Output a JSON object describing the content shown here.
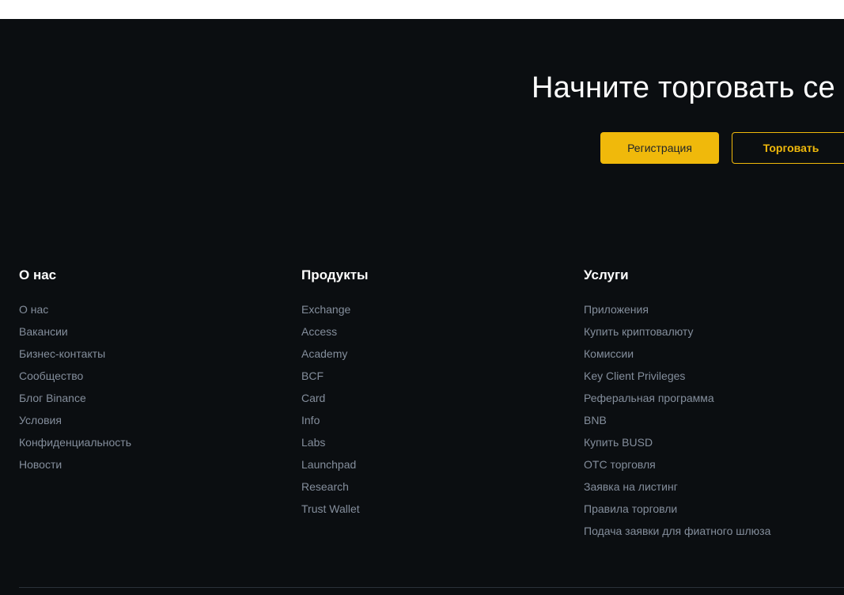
{
  "cta": {
    "title": "Начните торговать се",
    "register_label": "Регистрация",
    "trade_label": "Торговать"
  },
  "colors": {
    "background": "#0b0e11",
    "accent": "#f0b90b",
    "link": "#848e9c",
    "heading": "#ffffff"
  },
  "columns": [
    {
      "heading": "О нас",
      "links": [
        "О нас",
        "Вакансии",
        "Бизнес-контакты",
        "Сообщество",
        "Блог Binance",
        "Условия",
        "Конфиденциальность",
        "Новости"
      ]
    },
    {
      "heading": "Продукты",
      "links": [
        "Exchange",
        "Access",
        "Academy",
        "BCF",
        "Card",
        "Info",
        "Labs",
        "Launchpad",
        "Research",
        "Trust Wallet"
      ]
    },
    {
      "heading": "Услуги",
      "links": [
        "Приложения",
        "Купить криптовалюту",
        "Комиссии",
        "Key Client Privileges",
        "Реферальная программа",
        "BNB",
        "Купить BUSD",
        "OTC торговля",
        "Заявка на листинг",
        "Правила торговли",
        "Подача заявки для фиатного шлюза"
      ]
    }
  ]
}
